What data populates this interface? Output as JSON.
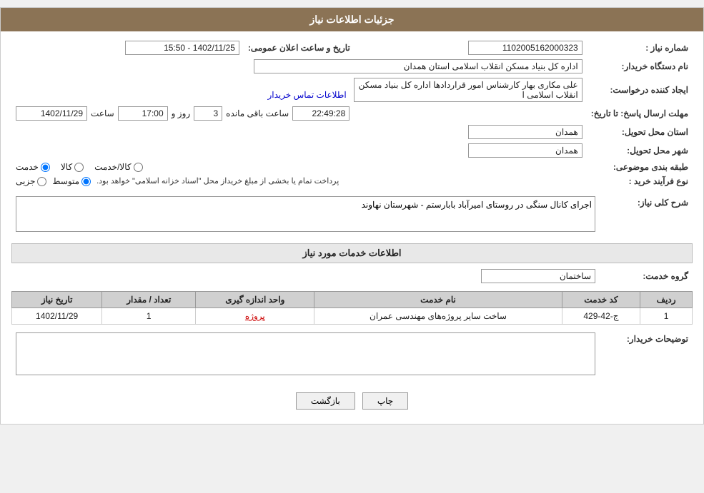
{
  "header": {
    "title": "جزئیات اطلاعات نیاز"
  },
  "fields": {
    "need_number_label": "شماره نیاز :",
    "need_number_value": "1102005162000323",
    "buyer_org_label": "نام دستگاه خریدار:",
    "buyer_org_value": "اداره کل بنیاد مسکن انقلاب اسلامی استان همدان",
    "requester_label": "ایجاد کننده درخواست:",
    "requester_value": "علی مکاری بهار کارشناس امور قراردادها اداره کل بنیاد مسکن انقلاب اسلامی ا",
    "requester_link": "اطلاعات تماس خریدار",
    "deadline_label": "مهلت ارسال پاسخ: تا تاریخ:",
    "deadline_date": "1402/11/29",
    "deadline_time_label": "ساعت",
    "deadline_time": "17:00",
    "deadline_day_label": "روز و",
    "deadline_days": "3",
    "deadline_remaining_label": "ساعت باقی مانده",
    "deadline_remaining": "22:49:28",
    "announcement_label": "تاریخ و ساعت اعلان عمومی:",
    "announcement_value": "1402/11/25 - 15:50",
    "province_label": "استان محل تحویل:",
    "province_value": "همدان",
    "city_label": "شهر محل تحویل:",
    "city_value": "همدان",
    "category_label": "طبقه بندی موضوعی:",
    "category_options": [
      "کالا",
      "خدمت",
      "کالا/خدمت"
    ],
    "category_selected": "خدمت",
    "purchase_type_label": "نوع فرآیند خرید :",
    "purchase_type_options": [
      "جزیی",
      "متوسط"
    ],
    "purchase_type_note": "پرداخت تمام یا بخشی از مبلغ خریداز محل \"اسناد خزانه اسلامی\" خواهد بود.",
    "need_desc_label": "شرح کلی نیاز:",
    "need_desc_value": "اجرای کانال سنگی در روستای امیرآباد بابارستم - شهرستان نهاوند",
    "services_section_label": "اطلاعات خدمات مورد نیاز",
    "service_group_label": "گروه خدمت:",
    "service_group_value": "ساختمان",
    "services_table": {
      "headers": [
        "ردیف",
        "کد خدمت",
        "نام خدمت",
        "واحد اندازه گیری",
        "تعداد / مقدار",
        "تاریخ نیاز"
      ],
      "rows": [
        {
          "row": "1",
          "code": "ج-42-429",
          "name": "ساخت سایر پروژه‌های مهندسی عمران",
          "unit": "پروژه",
          "quantity": "1",
          "date": "1402/11/29"
        }
      ]
    },
    "buyer_desc_label": "توضیحات خریدار:",
    "buyer_desc_value": ""
  },
  "buttons": {
    "back_label": "بازگشت",
    "print_label": "چاپ"
  }
}
